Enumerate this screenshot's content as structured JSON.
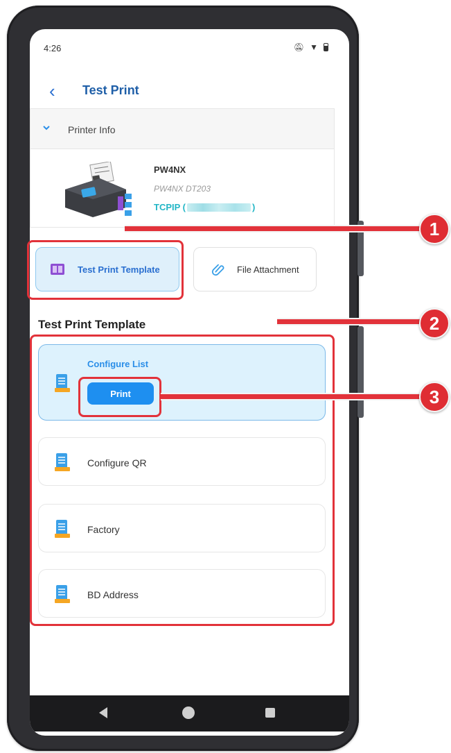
{
  "status": {
    "time": "4:26"
  },
  "appbar": {
    "title": "Test Print"
  },
  "printer_info": {
    "header": "Printer Info",
    "name": "PW4NX",
    "model": "PW4NX DT203",
    "connection": "TCPIP (",
    "connection_close": ")"
  },
  "tabs": [
    {
      "label": "Test Print Template",
      "icon": "template-icon",
      "selected": true
    },
    {
      "label": "File Attachment",
      "icon": "paperclip-icon",
      "selected": false
    }
  ],
  "section_title": "Test Print Template",
  "templates": [
    {
      "label": "Configure List",
      "selected": true,
      "action": "Print"
    },
    {
      "label": "Configure QR",
      "selected": false
    },
    {
      "label": "Factory",
      "selected": false
    },
    {
      "label": "BD Address",
      "selected": false
    }
  ],
  "callouts": [
    "1",
    "2",
    "3"
  ],
  "colors": {
    "accent": "#1e8ff0",
    "callout": "#e2323a",
    "title": "#1f5fa8",
    "connection": "#22b6c6"
  }
}
